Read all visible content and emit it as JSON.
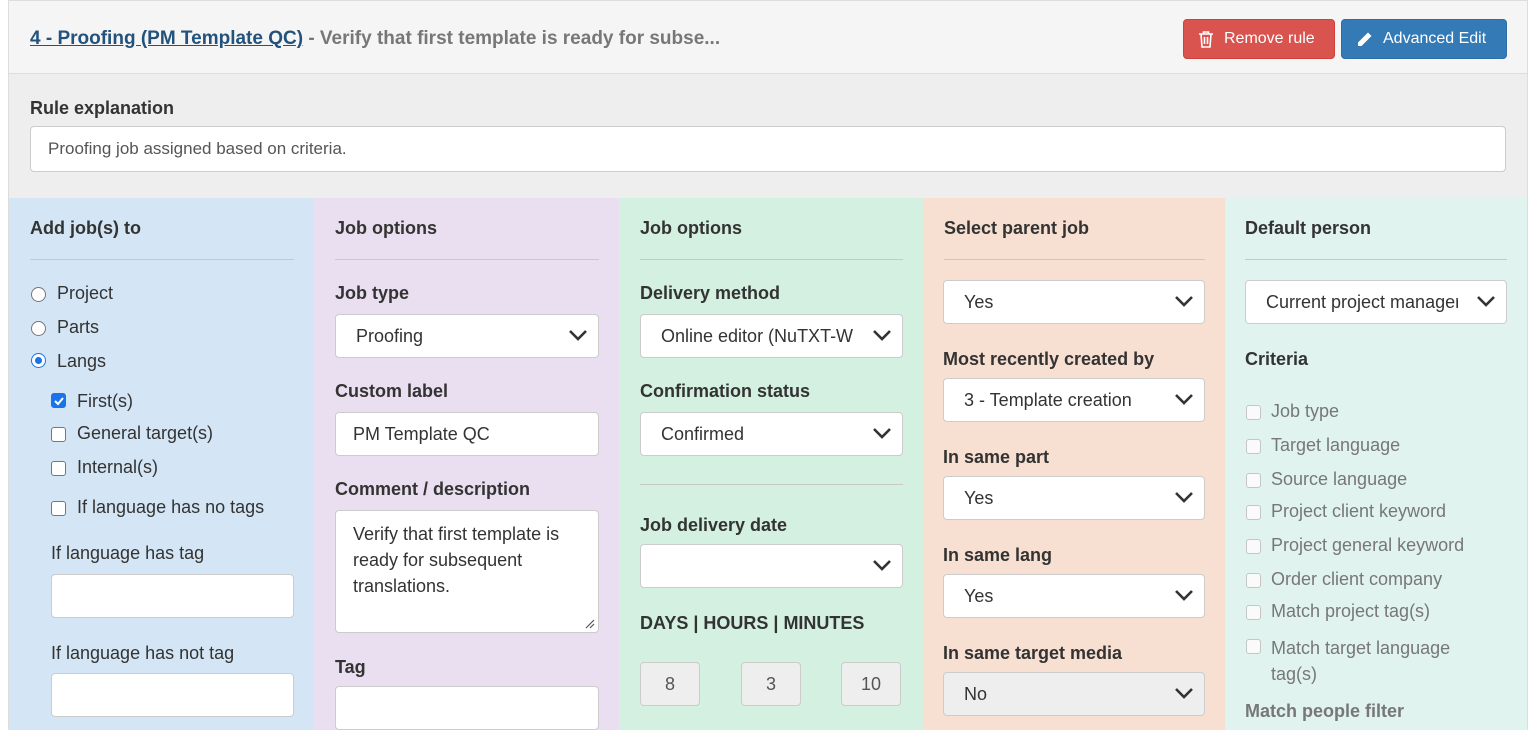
{
  "header": {
    "rule_link": "4 - Proofing (PM Template QC)",
    "rule_subtitle": " - Verify that first template is ready for subse...",
    "remove_label": "Remove rule",
    "advanced_label": "Advanced Edit"
  },
  "explanation": {
    "label": "Rule explanation",
    "value": "Proofing job assigned based on criteria."
  },
  "add_jobs": {
    "heading": "Add job(s) to",
    "radios": [
      {
        "label": "Project",
        "checked": false
      },
      {
        "label": "Parts",
        "checked": false
      },
      {
        "label": "Langs",
        "checked": true
      }
    ],
    "checks": [
      {
        "label": "First(s)",
        "checked": true
      },
      {
        "label": "General target(s)",
        "checked": false
      },
      {
        "label": "Internal(s)",
        "checked": false
      },
      {
        "label": "If language has no tags",
        "checked": false
      }
    ],
    "has_tag_label": "If language has tag",
    "has_tag_value": "",
    "has_not_tag_label": "If language has not tag",
    "has_not_tag_value": ""
  },
  "job_options_1": {
    "heading": "Job options",
    "job_type_label": "Job type",
    "job_type_value": "Proofing",
    "custom_label_label": "Custom label",
    "custom_label_value": "PM Template QC",
    "comment_label": "Comment / description",
    "comment_value": "Verify that first template is ready for subsequent translations.",
    "tag_label": "Tag",
    "tag_value": ""
  },
  "job_options_2": {
    "heading": "Job options",
    "delivery_method_label": "Delivery method",
    "delivery_method_value": "Online editor (NuTXT-W",
    "confirmation_label": "Confirmation status",
    "confirmation_value": "Confirmed",
    "delivery_date_label": "Job delivery date",
    "delivery_date_value": "",
    "dhm_label": "DAYS | HOURS | MINUTES",
    "days": "8",
    "hours": "3",
    "minutes": "10"
  },
  "parent_job": {
    "heading": "Select parent job",
    "select_value": "Yes",
    "recent_label": "Most recently created by",
    "recent_value": "3 - Template creation",
    "same_part_label": "In same part",
    "same_part_value": "Yes",
    "same_lang_label": "In same lang",
    "same_lang_value": "Yes",
    "same_media_label": "In same target media",
    "same_media_value": "No"
  },
  "default_person": {
    "heading": "Default person",
    "select_value": "Current project manager",
    "criteria_label": "Criteria",
    "criteria": [
      "Job type",
      "Target language",
      "Source language",
      "Project client keyword",
      "Project general keyword",
      "Order client company",
      "Match project tag(s)",
      "Match target language tag(s)"
    ],
    "match_filter_label": "Match people filter"
  }
}
